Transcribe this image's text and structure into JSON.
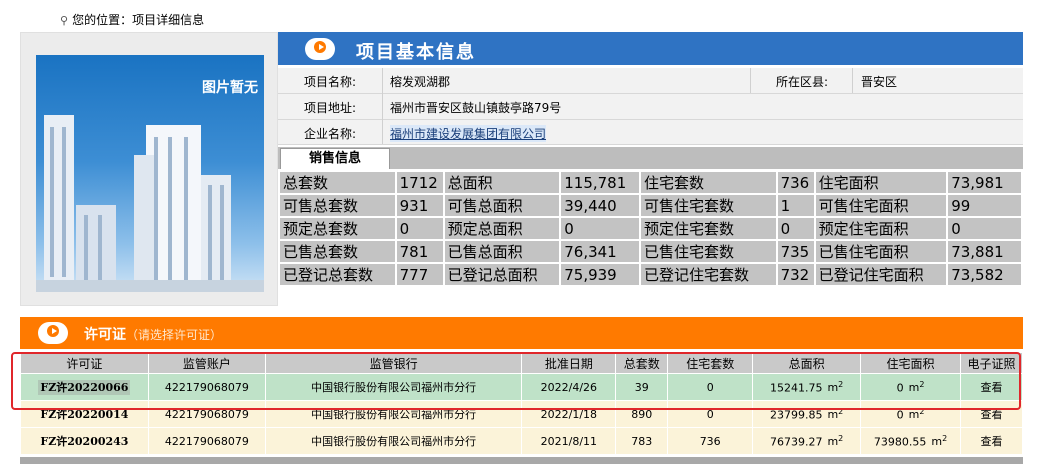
{
  "breadcrumb": {
    "prefix": "您的位置：",
    "current": "项目详细信息"
  },
  "image_panel": {
    "no_image_text": "图片暂无"
  },
  "basic_info": {
    "title": "项目基本信息",
    "project_name_label": "项目名称:",
    "project_name": "榕发观湖郡",
    "district_label": "所在区县:",
    "district": "晋安区",
    "address_label": "项目地址:",
    "address": "福州市晋安区鼓山镇鼓亭路79号",
    "company_label": "企业名称:",
    "company": "福州市建设发展集团有限公司"
  },
  "sales": {
    "tab_label": "销售信息",
    "rows": [
      [
        "总套数",
        "1712",
        "总面积",
        "115,781",
        "住宅套数",
        "736",
        "住宅面积",
        "73,981"
      ],
      [
        "可售总套数",
        "931",
        "可售总面积",
        "39,440",
        "可售住宅套数",
        "1",
        "可售住宅面积",
        "99"
      ],
      [
        "预定总套数",
        "0",
        "预定总面积",
        "0",
        "预定住宅套数",
        "0",
        "预定住宅面积",
        "0"
      ],
      [
        "已售总套数",
        "781",
        "已售总面积",
        "76,341",
        "已售住宅套数",
        "735",
        "已售住宅面积",
        "73,881"
      ],
      [
        "已登记总套数",
        "777",
        "已登记总面积",
        "75,939",
        "已登记住宅套数",
        "732",
        "已登记住宅面积",
        "73,582"
      ]
    ]
  },
  "permit": {
    "title": "许可证",
    "hint": "（请选择许可证）",
    "headers": [
      "许可证",
      "监管账户",
      "监管银行",
      "批准日期",
      "总套数",
      "住宅套数",
      "总面积",
      "住宅面积",
      "电子证照"
    ],
    "unit": "m",
    "unit_sup": "2",
    "rows": [
      {
        "id": "FZ许20220066",
        "account": "422179068079",
        "bank": "中国银行股份有限公司福州市分行",
        "date": "2022/4/26",
        "total": "39",
        "residential": "0",
        "area": "15241.75",
        "res_area": "0",
        "action": "查看"
      },
      {
        "id": "FZ许20220014",
        "account": "422179068079",
        "bank": "中国银行股份有限公司福州市分行",
        "date": "2022/1/18",
        "total": "890",
        "residential": "0",
        "area": "23799.85",
        "res_area": "0",
        "action": "查看"
      },
      {
        "id": "FZ许20200243",
        "account": "422179068079",
        "bank": "中国银行股份有限公司福州市分行",
        "date": "2021/8/11",
        "total": "783",
        "residential": "736",
        "area": "76739.27",
        "res_area": "73980.55",
        "action": "查看"
      }
    ]
  },
  "colors": {
    "blue_header": "#2f73c3",
    "orange_header": "#ff7a00",
    "selection_border": "#e0262b",
    "selected_row": "#bfe2c8"
  }
}
